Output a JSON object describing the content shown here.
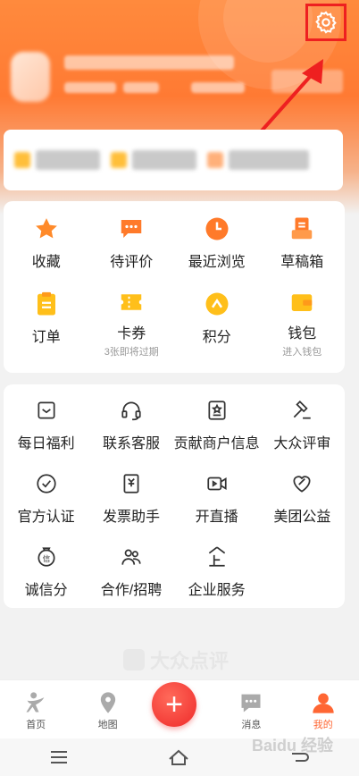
{
  "colors": {
    "accent": "#ff7a33",
    "highlight": "#ee2020",
    "icon_orange": "#ff8a2a",
    "icon_yellow": "#ffbf1a"
  },
  "header": {
    "settings_icon": "gear-icon"
  },
  "quick_menu": [
    {
      "label": "收藏",
      "sub": "",
      "icon": "star-icon"
    },
    {
      "label": "待评价",
      "sub": "",
      "icon": "comment-icon"
    },
    {
      "label": "最近浏览",
      "sub": "",
      "icon": "clock-icon"
    },
    {
      "label": "草稿箱",
      "sub": "",
      "icon": "drafts-icon"
    },
    {
      "label": "订单",
      "sub": "",
      "icon": "order-icon"
    },
    {
      "label": "卡券",
      "sub": "3张即将过期",
      "icon": "coupon-icon"
    },
    {
      "label": "积分",
      "sub": "",
      "icon": "points-icon"
    },
    {
      "label": "钱包",
      "sub": "进入钱包",
      "icon": "wallet-icon"
    }
  ],
  "services": [
    {
      "label": "每日福利",
      "icon": "gift-icon"
    },
    {
      "label": "联系客服",
      "icon": "headset-icon"
    },
    {
      "label": "贡献商户信息",
      "icon": "shop-icon"
    },
    {
      "label": "大众评审",
      "icon": "gavel-icon"
    },
    {
      "label": "官方认证",
      "icon": "check-circle-icon"
    },
    {
      "label": "发票助手",
      "icon": "invoice-icon"
    },
    {
      "label": "开直播",
      "icon": "video-icon"
    },
    {
      "label": "美团公益",
      "icon": "heart-icon"
    },
    {
      "label": "诚信分",
      "icon": "credit-icon"
    },
    {
      "label": "合作/招聘",
      "icon": "people-icon"
    },
    {
      "label": "企业服务",
      "icon": "enterprise-icon"
    }
  ],
  "brand": {
    "name": "大众点评"
  },
  "tabbar": [
    {
      "label": "首页",
      "icon": "home-icon"
    },
    {
      "label": "地图",
      "icon": "map-pin-icon"
    },
    {
      "label": "",
      "icon": "plus-icon"
    },
    {
      "label": "消息",
      "icon": "message-icon"
    },
    {
      "label": "我的",
      "icon": "user-icon"
    }
  ],
  "plus_symbol": "+",
  "watermark": "Baidu 经验"
}
